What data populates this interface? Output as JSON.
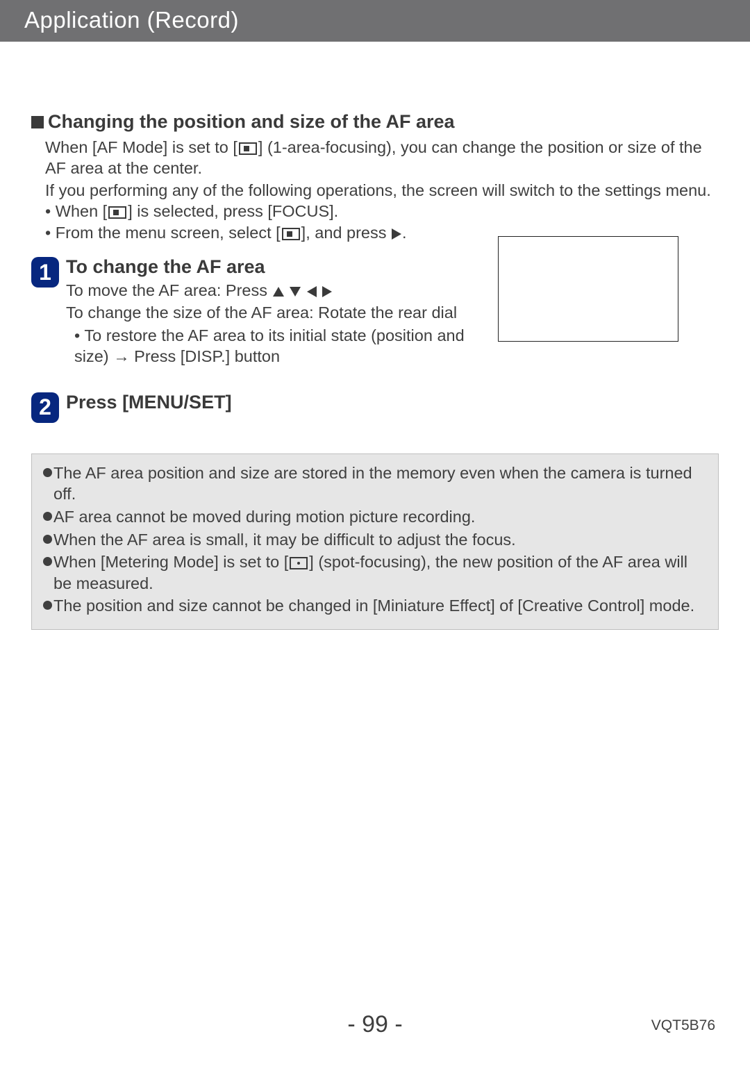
{
  "header": {
    "title": "Application (Record)"
  },
  "section": {
    "heading": "Changing the position and size of the AF area",
    "para1a": "When [AF Mode] is set to [",
    "para1b": "] (1-area-focusing), you can change the position or size of the AF area at the center.",
    "para2": "If you performing any of the following operations, the screen will switch to the settings menu.",
    "bullet1a": "When [",
    "bullet1b": "] is selected, press [FOCUS].",
    "bullet2a": "From the menu screen, select [",
    "bullet2b": "], and press ",
    "bullet2c": "."
  },
  "steps": {
    "s1": {
      "num": "1",
      "heading": "To change the AF area",
      "line1": "To move the AF area: Press ",
      "line2": "To change the size of the AF area: Rotate the rear dial",
      "sub1": "To restore the AF area to its initial state (position and size) → Press [DISP.] button"
    },
    "s2": {
      "num": "2",
      "heading": "Press [MENU/SET]"
    }
  },
  "notes": {
    "n1": "The AF area position and size are stored in the memory even when the camera is turned off.",
    "n2": "AF area cannot be moved during motion picture recording.",
    "n3": "When the AF area is small, it may be difficult to adjust the focus.",
    "n4a": "When [Metering Mode] is set to [",
    "n4b": "] (spot-focusing), the new position of the AF area will be measured.",
    "n5": "The position and size cannot be changed in [Miniature Effect] of [Creative Control] mode."
  },
  "footer": {
    "page": "- 99 -",
    "docid": "VQT5B76"
  }
}
